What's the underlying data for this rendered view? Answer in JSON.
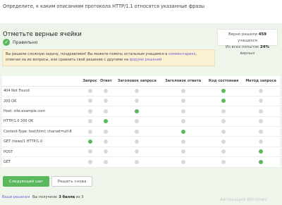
{
  "question": "Определите, к каким описаниям протокола HTTP/1.1 относятся указанные фразы",
  "panel_title": "Отметьте верные ячейки",
  "status": {
    "label": "Правильно",
    "icon": "check-circle-icon",
    "color": "#5cb85c"
  },
  "stats": {
    "line1_prefix": "Верно решили",
    "line1_count": "459",
    "line1_suffix": "учащихся",
    "line2_prefix": "Из всех попыток",
    "line2_percent": "24%",
    "line2_suffix": "верных"
  },
  "congrats": {
    "text1": "Вы решили сложную задачу, поздравляем! Вы можете помочь остальным учащимся в",
    "link1": "комментариях",
    "text2": ", отвечая на их вопросы, или сравнить своё решение с другими на",
    "link2": "форуме решений"
  },
  "table": {
    "headers": [
      "Запрос",
      "Ответ",
      "Заголовок запроса",
      "Заголовок ответа",
      "Код состояния",
      "Метод запроса"
    ],
    "rows": [
      {
        "label": "404 Not Found",
        "checked": [
          false,
          false,
          false,
          false,
          true,
          false
        ]
      },
      {
        "label": "200 OK",
        "checked": [
          false,
          false,
          false,
          false,
          true,
          false
        ]
      },
      {
        "label": "Host: site.example.com",
        "checked": [
          false,
          false,
          true,
          false,
          false,
          false
        ]
      },
      {
        "label": "HTTP/1.0 200 OK",
        "checked": [
          false,
          true,
          false,
          false,
          false,
          false
        ]
      },
      {
        "label": "Content-Type: text/html; charset=utf-8",
        "checked": [
          false,
          false,
          false,
          true,
          false,
          false
        ]
      },
      {
        "label": "GET /news/1 HTTP/1.0",
        "checked": [
          true,
          false,
          false,
          false,
          false,
          false
        ]
      },
      {
        "label": "POST",
        "checked": [
          false,
          false,
          false,
          false,
          false,
          true
        ]
      },
      {
        "label": "GET",
        "checked": [
          false,
          false,
          false,
          false,
          false,
          true
        ]
      }
    ]
  },
  "buttons": {
    "next": "Следующий шаг",
    "retry": "Решить снова"
  },
  "footer": {
    "link": "Ваши решения",
    "score_prefix": "Вы получили:",
    "score_value": "3 балла",
    "score_suffix": "из 3"
  },
  "watermark": "Активация Windows",
  "colors": {
    "accent": "#5cb85c",
    "panel_bg": "#eef6ec",
    "notice_bg": "#fcf0d2",
    "link": "#7a5cd9"
  }
}
